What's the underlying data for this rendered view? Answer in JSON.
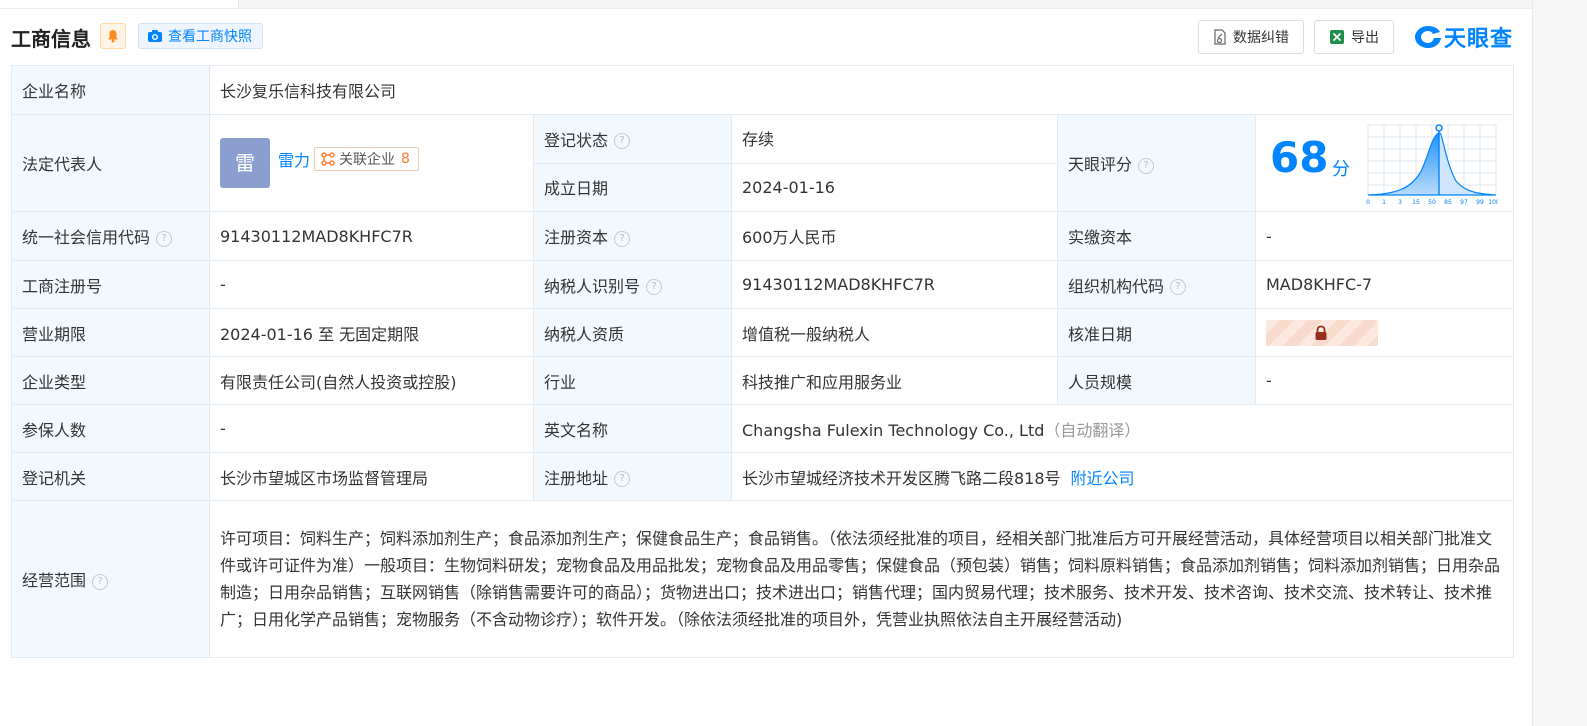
{
  "header": {
    "title": "工商信息",
    "snapshot_label": "查看工商快照",
    "correct_label": "数据纠错",
    "export_label": "导出",
    "brand": "天眼查"
  },
  "company": {
    "name_label": "企业名称",
    "name": "长沙复乐信科技有限公司",
    "legal_rep_label": "法定代表人",
    "avatar_char": "雷",
    "legal_rep": "雷力",
    "related_label": "关联企业",
    "related_count": "8",
    "reg_status_label": "登记状态",
    "reg_status": "存续",
    "found_date_label": "成立日期",
    "found_date": "2024-01-16",
    "score_label": "天眼评分",
    "score": "68",
    "score_unit": "分",
    "score_ticks": [
      "0",
      "1",
      "3",
      "15",
      "50",
      "85",
      "97",
      "99",
      "100"
    ],
    "credit_code_label": "统一社会信用代码",
    "credit_code": "91430112MAD8KHFC7R",
    "reg_capital_label": "注册资本",
    "reg_capital": "600万人民币",
    "paid_capital_label": "实缴资本",
    "paid_capital": "-",
    "reg_no_label": "工商注册号",
    "reg_no": "-",
    "taxpayer_id_label": "纳税人识别号",
    "taxpayer_id": "91430112MAD8KHFC7R",
    "org_code_label": "组织机构代码",
    "org_code": "MAD8KHFC-7",
    "term_label": "营业期限",
    "term": "2024-01-16 至 无固定期限",
    "taxpayer_type_label": "纳税人资质",
    "taxpayer_type": "增值税一般纳税人",
    "approve_date_label": "核准日期",
    "type_label": "企业类型",
    "type": "有限责任公司(自然人投资或控股)",
    "industry_label": "行业",
    "industry": "科技推广和应用服务业",
    "staff_label": "人员规模",
    "staff": "-",
    "insured_label": "参保人数",
    "insured": "-",
    "en_name_label": "英文名称",
    "en_name": "Changsha Fulexin Technology Co., Ltd",
    "auto_translate": "（自动翻译）",
    "authority_label": "登记机关",
    "authority": "长沙市望城区市场监督管理局",
    "address_label": "注册地址",
    "address": "长沙市望城经济技术开发区腾飞路二段818号",
    "nearby_label": "附近公司",
    "scope_label": "经营范围",
    "scope": "许可项目：饲料生产；饲料添加剂生产；食品添加剂生产；保健食品生产；食品销售。（依法须经批准的项目，经相关部门批准后方可开展经营活动，具体经营项目以相关部门批准文件或许可证件为准）一般项目：生物饲料研发；宠物食品及用品批发；宠物食品及用品零售；保健食品（预包装）销售；饲料原料销售；食品添加剂销售；饲料添加剂销售；日用杂品制造；日用杂品销售；互联网销售（除销售需要许可的商品）；货物进出口；技术进出口；销售代理；国内贸易代理；技术服务、技术开发、技术咨询、技术交流、技术转让、技术推广；日用化学产品销售；宠物服务（不含动物诊疗）；软件开发。（除依法须经批准的项目外，凭营业执照依法自主开展经营活动)"
  },
  "colors": {
    "accent": "#0084ff",
    "label_bg": "#f2f9fe",
    "status_green": "#19a55a",
    "badge_orange": "#ff7a2e"
  },
  "icons": {
    "bell": "bell-icon",
    "camera": "camera-icon",
    "correct": "document-edit-icon",
    "export": "excel-icon",
    "brand": "tianyancha-logo",
    "question": "question-circle-icon",
    "lock": "lock-icon",
    "related": "network-icon"
  }
}
